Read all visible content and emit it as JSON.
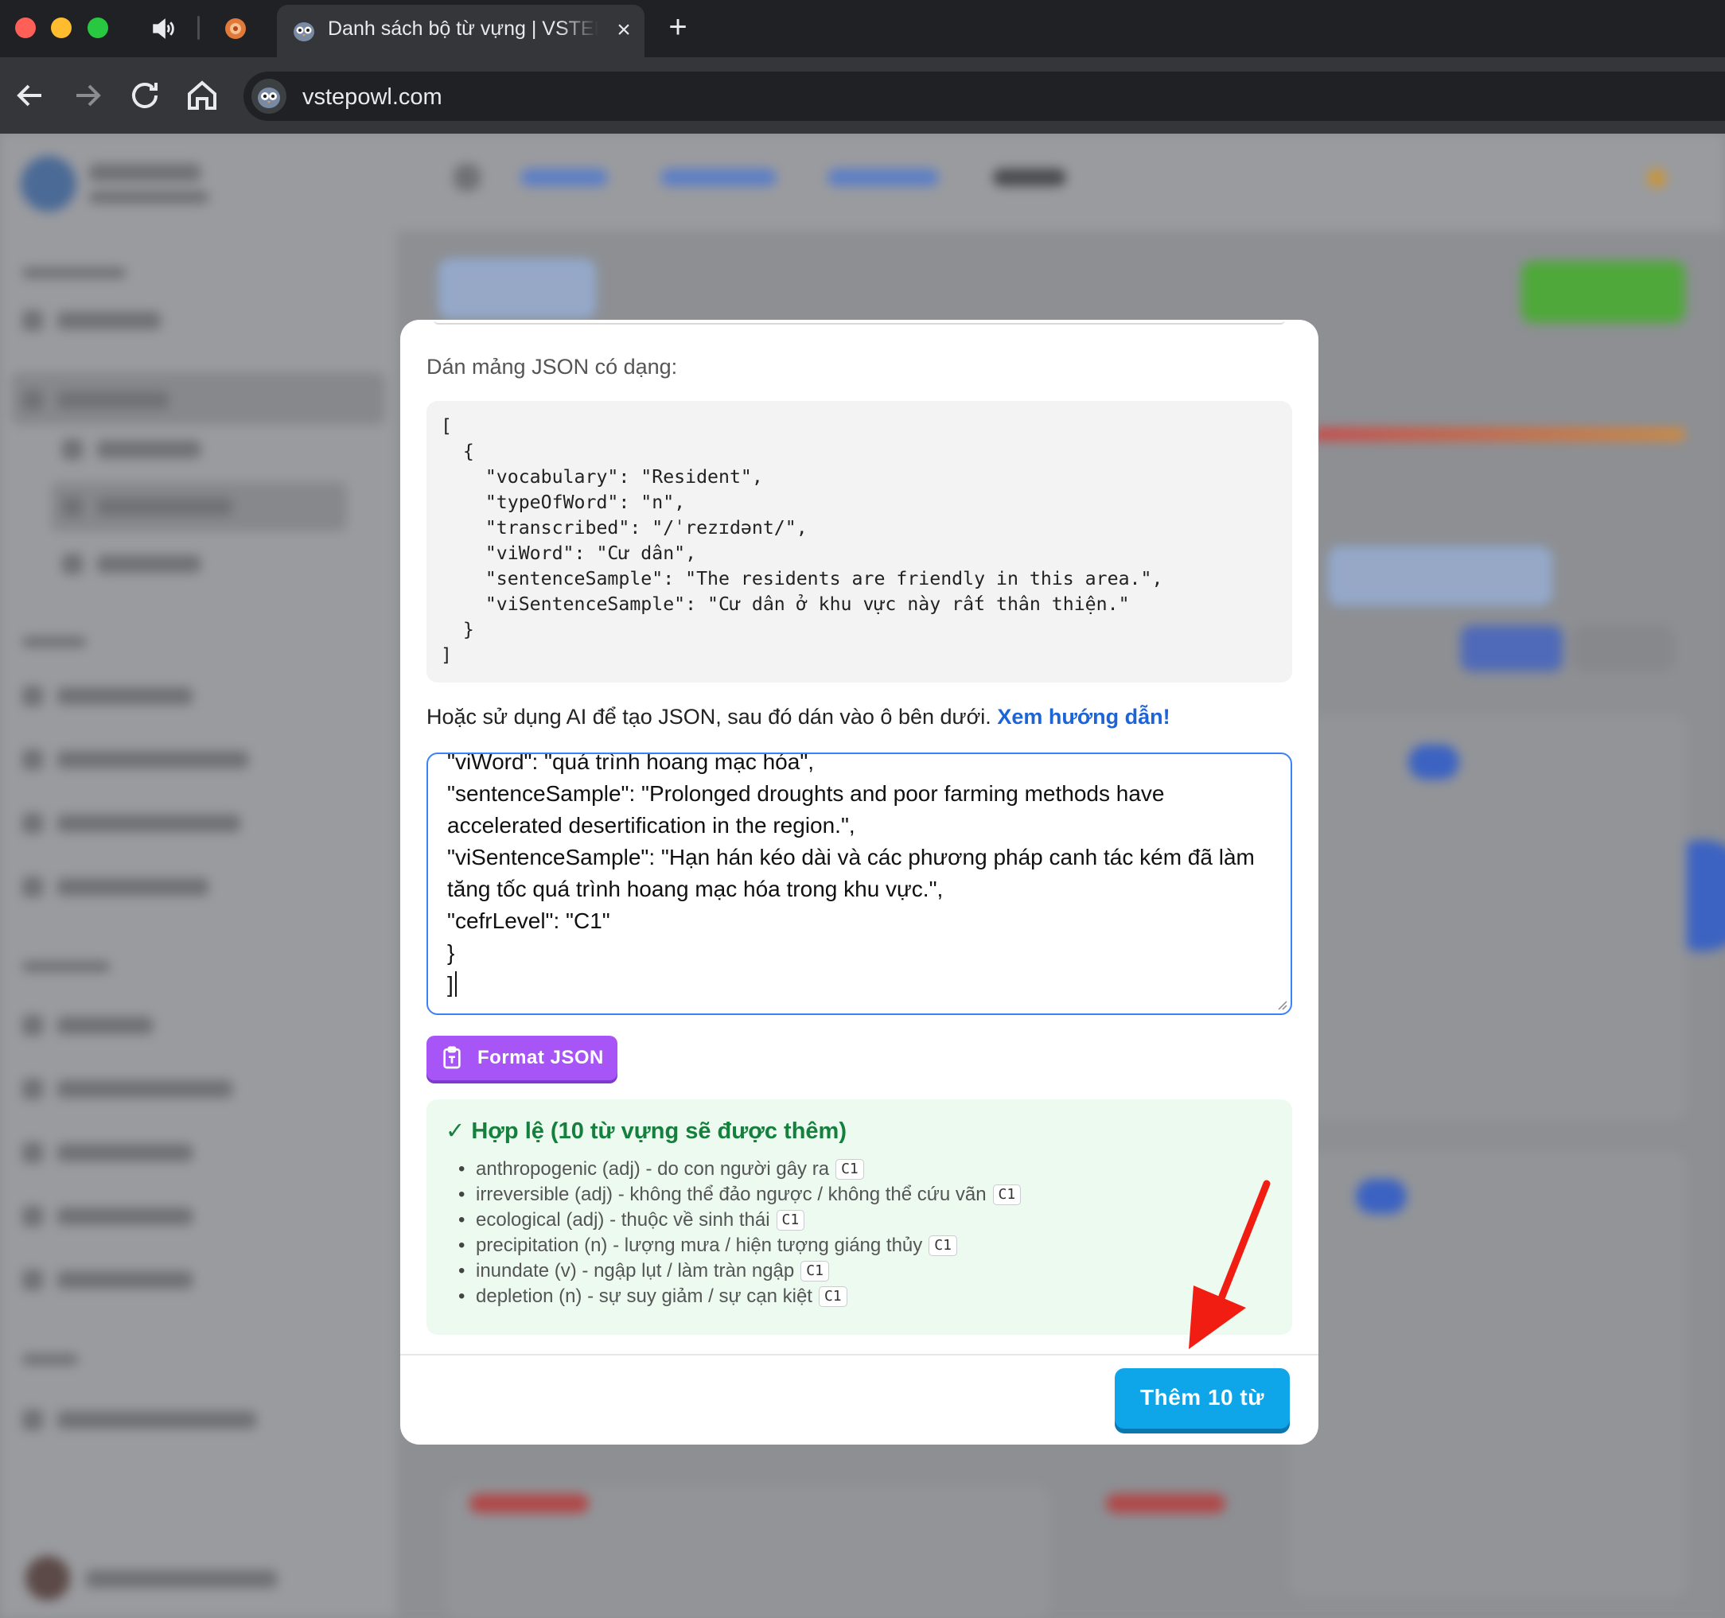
{
  "browser": {
    "tab_title": "Danh sách bộ từ vựng | VSTEP Owl",
    "tab_close": "×",
    "new_tab": "+",
    "url": "vstepowl.com"
  },
  "modal": {
    "paste_label": "Dán mảng JSON có dạng:",
    "sample_json": "[\n  {\n    \"vocabulary\": \"Resident\",\n    \"typeOfWord\": \"n\",\n    \"transcribed\": \"/ˈrezɪdənt/\",\n    \"viWord\": \"Cư dân\",\n    \"sentenceSample\": \"The residents are friendly in this area.\",\n    \"viSentenceSample\": \"Cư dân ở khu vực này rất thân thiện.\"\n  }\n]",
    "ai_hint": "Hoặc sử dụng AI để tạo JSON, sau đó dán vào ô bên dưới.",
    "guide_link": "Xem hướng dẫn!",
    "textarea_value": "\"viWord\": \"quá trình hoang mạc hóa\",\n\"sentenceSample\": \"Prolonged droughts and poor farming methods have accelerated desertification in the region.\",\n\"viSentenceSample\": \"Hạn hán kéo dài và các phương pháp canh tác kém đã làm tăng tốc quá trình hoang mạc hóa trong khu vực.\",\n\"cefrLevel\": \"C1\"\n}\n]",
    "format_button": "Format JSON",
    "valid_title": "✓ Hợp lệ (10 từ vựng sẽ được thêm)",
    "valid_items": [
      {
        "text": "anthropogenic (adj) - do con người gây ra",
        "level": "C1"
      },
      {
        "text": "irreversible (adj) - không thể đảo ngược / không thể cứu vãn",
        "level": "C1"
      },
      {
        "text": "ecological (adj) - thuộc về sinh thái",
        "level": "C1"
      },
      {
        "text": "precipitation (n) - lượng mưa / hiện tượng giáng thủy",
        "level": "C1"
      },
      {
        "text": "inundate (v) - ngập lụt / làm tràn ngập",
        "level": "C1"
      },
      {
        "text": "depletion (n) - sự suy giảm / sự cạn kiệt",
        "level": "C1"
      }
    ],
    "add_button": "Thêm 10 từ"
  },
  "colors": {
    "accent_blue": "#0ea5e9",
    "format_purple": "#a855f7",
    "valid_green": "#15803d",
    "arrow_red": "#f21d12"
  }
}
